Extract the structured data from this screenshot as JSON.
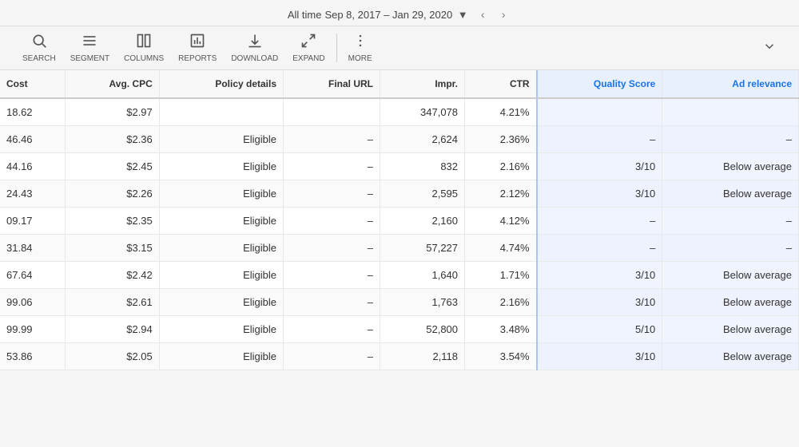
{
  "topbar": {
    "alltime_label": "All time",
    "date_range": "Sep 8, 2017 – Jan 29, 2020"
  },
  "toolbar": {
    "items": [
      {
        "id": "search",
        "label": "SEARCH",
        "icon": "🔍"
      },
      {
        "id": "segment",
        "label": "SEGMENT",
        "icon": "≡"
      },
      {
        "id": "columns",
        "label": "COLUMNS",
        "icon": "▦"
      },
      {
        "id": "reports",
        "label": "REPORTS",
        "icon": "📊"
      },
      {
        "id": "download",
        "label": "DOWNLOAD",
        "icon": "⬇"
      },
      {
        "id": "expand",
        "label": "EXPAND",
        "icon": "⤢"
      },
      {
        "id": "more",
        "label": "MORE",
        "icon": "⋮"
      }
    ]
  },
  "table": {
    "columns": [
      {
        "id": "cost",
        "label": "Cost",
        "highlighted": false
      },
      {
        "id": "avg_cpc",
        "label": "Avg. CPC",
        "highlighted": false
      },
      {
        "id": "policy",
        "label": "Policy details",
        "highlighted": false
      },
      {
        "id": "final_url",
        "label": "Final URL",
        "highlighted": false
      },
      {
        "id": "impr",
        "label": "Impr.",
        "highlighted": false
      },
      {
        "id": "ctr",
        "label": "CTR",
        "highlighted": false
      },
      {
        "id": "quality_score",
        "label": "Quality Score",
        "highlighted": true
      },
      {
        "id": "ad_relevance",
        "label": "Ad relevance",
        "highlighted": true
      }
    ],
    "rows": [
      {
        "cost": "18.62",
        "avg_cpc": "$2.97",
        "policy": "",
        "final_url": "",
        "impr": "347,078",
        "ctr": "4.21%",
        "quality_score": "",
        "ad_relevance": ""
      },
      {
        "cost": "46.46",
        "avg_cpc": "$2.36",
        "policy": "Eligible",
        "final_url": "–",
        "impr": "2,624",
        "ctr": "2.36%",
        "quality_score": "–",
        "ad_relevance": "–"
      },
      {
        "cost": "44.16",
        "avg_cpc": "$2.45",
        "policy": "Eligible",
        "final_url": "–",
        "impr": "832",
        "ctr": "2.16%",
        "quality_score": "3/10",
        "ad_relevance": "Below average"
      },
      {
        "cost": "24.43",
        "avg_cpc": "$2.26",
        "policy": "Eligible",
        "final_url": "–",
        "impr": "2,595",
        "ctr": "2.12%",
        "quality_score": "3/10",
        "ad_relevance": "Below average"
      },
      {
        "cost": "09.17",
        "avg_cpc": "$2.35",
        "policy": "Eligible",
        "final_url": "–",
        "impr": "2,160",
        "ctr": "4.12%",
        "quality_score": "–",
        "ad_relevance": "–"
      },
      {
        "cost": "31.84",
        "avg_cpc": "$3.15",
        "policy": "Eligible",
        "final_url": "–",
        "impr": "57,227",
        "ctr": "4.74%",
        "quality_score": "–",
        "ad_relevance": "–"
      },
      {
        "cost": "67.64",
        "avg_cpc": "$2.42",
        "policy": "Eligible",
        "final_url": "–",
        "impr": "1,640",
        "ctr": "1.71%",
        "quality_score": "3/10",
        "ad_relevance": "Below average"
      },
      {
        "cost": "99.06",
        "avg_cpc": "$2.61",
        "policy": "Eligible",
        "final_url": "–",
        "impr": "1,763",
        "ctr": "2.16%",
        "quality_score": "3/10",
        "ad_relevance": "Below average"
      },
      {
        "cost": "99.99",
        "avg_cpc": "$2.94",
        "policy": "Eligible",
        "final_url": "–",
        "impr": "52,800",
        "ctr": "3.48%",
        "quality_score": "5/10",
        "ad_relevance": "Below average"
      },
      {
        "cost": "53.86",
        "avg_cpc": "$2.05",
        "policy": "Eligible",
        "final_url": "–",
        "impr": "2,118",
        "ctr": "3.54%",
        "quality_score": "3/10",
        "ad_relevance": "Below average"
      }
    ]
  }
}
